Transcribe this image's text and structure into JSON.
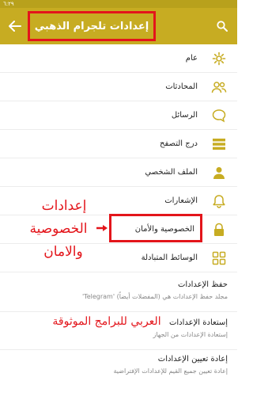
{
  "status_bar": {
    "time": "٦:٢٩"
  },
  "toolbar": {
    "title": "إعدادات تلجرام الذهبي"
  },
  "settings_items": [
    {
      "label": "عام",
      "icon": "gear-icon"
    },
    {
      "label": "المحادثات",
      "icon": "people-icon"
    },
    {
      "label": "الرسائل",
      "icon": "chat-bubble-icon"
    },
    {
      "label": "درج التصفح",
      "icon": "list-icon"
    },
    {
      "label": "الملف الشخصي",
      "icon": "person-icon"
    },
    {
      "label": "الإشعارات",
      "icon": "bell-icon"
    },
    {
      "label": "الخصوصية والأمان",
      "icon": "lock-icon"
    },
    {
      "label": "الوسائط المتبادلة",
      "icon": "grid-icon"
    }
  ],
  "sections": [
    {
      "title": "حفظ الإعدادات",
      "subtitle": "مجلد حفظ الإعدادات هي (المفضلات أيضاً) 'Telegram'"
    },
    {
      "title": "إستعادة الإعدادات",
      "subtitle": "إستعادة الإعدادات من الجهاز"
    },
    {
      "title": "إعادة تعيين الإعدادات",
      "subtitle": "إعادة تعيين جميع القيم للإعدادات الإفتراضية"
    }
  ],
  "annotations": {
    "line1": "إعدادات",
    "line2": "الخصوصية",
    "line3": "والامان",
    "watermark": "العربي للبرامج الموثوقة"
  },
  "colors": {
    "toolbar": "#c7ac22",
    "accent_icon": "#c7ac22",
    "annotation": "#e3151b"
  }
}
